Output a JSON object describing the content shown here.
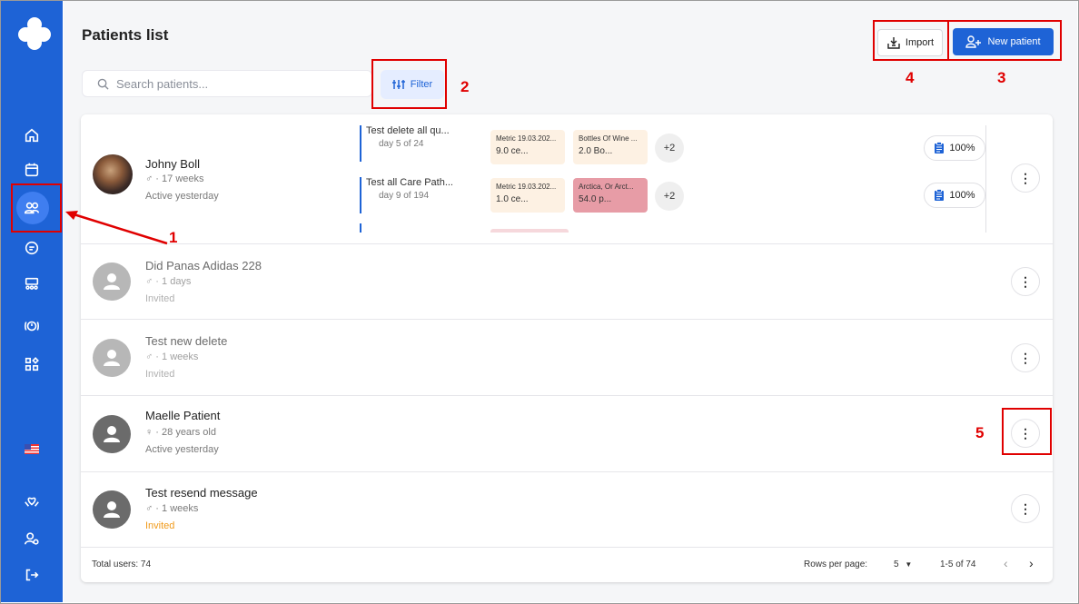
{
  "page": {
    "title": "Patients list"
  },
  "search": {
    "placeholder": "Search patients..."
  },
  "toolbar": {
    "filter_label": "Filter",
    "import_label": "Import",
    "new_patient_label": "New patient"
  },
  "patients": [
    {
      "name": "Johny Boll",
      "meta": "♂ · 17 weeks",
      "status": "Active yesterday",
      "care_paths": [
        {
          "title": "Test delete all qu...",
          "progress": "day 5 of 24",
          "metrics": [
            {
              "title": "Metric 19.03.202...",
              "value": "9.0 ce..."
            },
            {
              "title": "Bottles Of Wine ...",
              "value": "2.0 Bo..."
            }
          ],
          "more": "+2",
          "compliance": "100%"
        },
        {
          "title": "Test all Care Path...",
          "progress": "day 9 of 194",
          "metrics": [
            {
              "title": "Metric 19.03.202...",
              "value": "1.0 ce..."
            },
            {
              "title": "Arctica, Or Arct...",
              "value": "54.0 p..."
            }
          ],
          "more": "+2",
          "compliance": "100%"
        }
      ]
    },
    {
      "name": "Did Panas Adidas 228",
      "meta": "♂ · 1 days",
      "status": "Invited"
    },
    {
      "name": "Test new delete",
      "meta": "♂ · 1 weeks",
      "status": "Invited"
    },
    {
      "name": "Maelle Patient",
      "meta": "♀ · 28 years old",
      "status": "Active yesterday"
    },
    {
      "name": "Test resend message",
      "meta": "♂ · 1 weeks",
      "status": "Invited"
    }
  ],
  "kebab_symbol": "⋮",
  "footer": {
    "total": "Total users: 74",
    "rows_per_page_label": "Rows per page:",
    "rows_per_page_value": "5",
    "range": "1-5 of 74",
    "prev": "‹",
    "next": "›"
  },
  "annotations": [
    "1",
    "2",
    "3",
    "4",
    "5"
  ],
  "colors": {
    "sidebar": "#1e63d6",
    "accent": "#1e63d6",
    "annotation": "#e00000",
    "invited": "#f09a1a"
  }
}
